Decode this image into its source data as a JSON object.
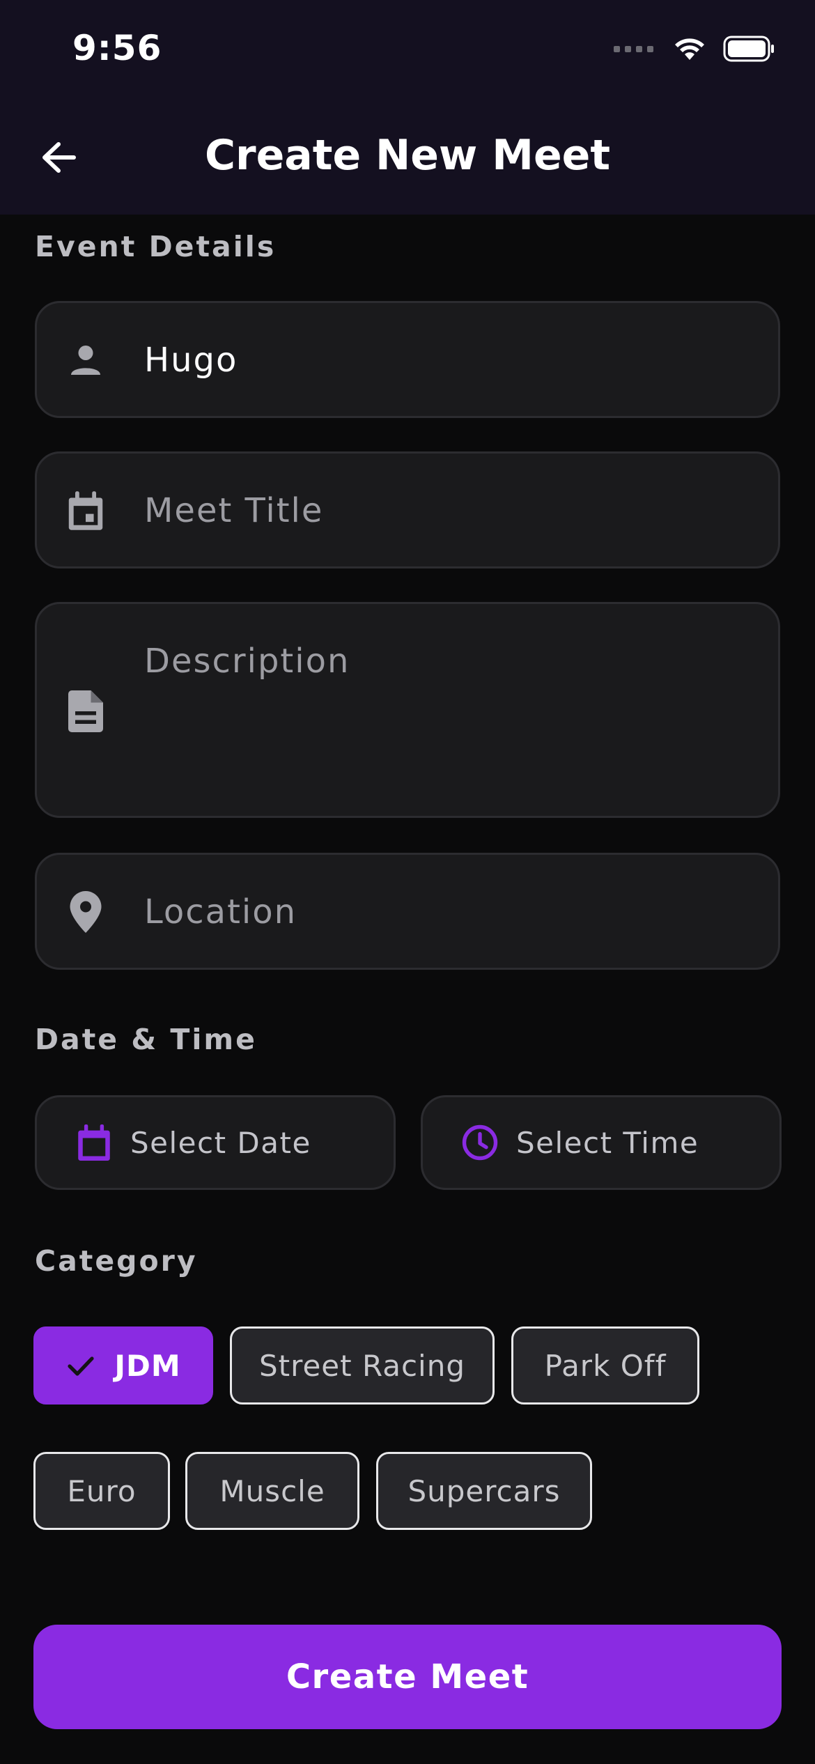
{
  "status_bar": {
    "time": "9:56"
  },
  "app_bar": {
    "title": "Create New Meet",
    "back_icon": "arrow-back-icon"
  },
  "event_details": {
    "label": "Event Details",
    "name_field": {
      "value": "Hugo",
      "icon": "person-icon"
    },
    "title_field": {
      "placeholder": "Meet Title",
      "icon": "calendar-event-icon"
    },
    "description_field": {
      "placeholder": "Description",
      "icon": "document-icon"
    },
    "location_field": {
      "placeholder": "Location",
      "icon": "location-pin-icon"
    }
  },
  "date_time": {
    "label": "Date & Time",
    "date_button": {
      "label": "Select Date",
      "icon": "calendar-icon"
    },
    "time_button": {
      "label": "Select Time",
      "icon": "clock-icon"
    }
  },
  "category": {
    "label": "Category",
    "chips": [
      {
        "label": "JDM",
        "selected": true
      },
      {
        "label": "Street Racing",
        "selected": false
      },
      {
        "label": "Park Off",
        "selected": false
      },
      {
        "label": "Euro",
        "selected": false
      },
      {
        "label": "Muscle",
        "selected": false
      },
      {
        "label": "Supercars",
        "selected": false
      }
    ]
  },
  "submit": {
    "label": "Create Meet"
  },
  "colors": {
    "accent": "#8a2be2",
    "app_bar_bg": "#141020",
    "page_bg": "#0a0a0b",
    "field_bg": "#1a1a1c"
  }
}
